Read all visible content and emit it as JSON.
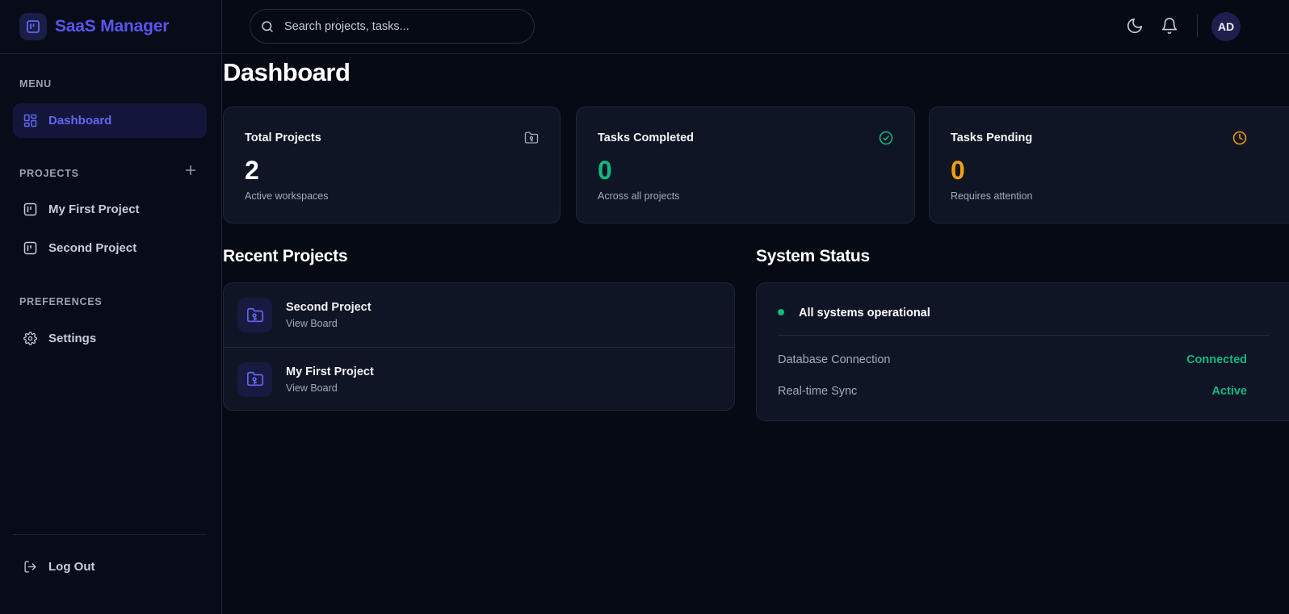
{
  "app": {
    "name": "SaaS Manager",
    "brand_color": "#5b54f0"
  },
  "sidebar": {
    "menu_label": "MENU",
    "menu_items": [
      {
        "label": "Dashboard",
        "icon": "grid-icon",
        "active": true
      }
    ],
    "projects_label": "PROJECTS",
    "projects": [
      {
        "label": "My First Project",
        "icon": "board-icon"
      },
      {
        "label": "Second Project",
        "icon": "board-icon"
      }
    ],
    "preferences_label": "PREFERENCES",
    "preference_items": [
      {
        "label": "Settings",
        "icon": "gear-icon"
      }
    ],
    "logout_label": "Log Out"
  },
  "header": {
    "search_placeholder": "Search projects, tasks...",
    "avatar_initials": "AD"
  },
  "main": {
    "title": "Dashboard",
    "stats": [
      {
        "title": "Total Projects",
        "value": "2",
        "subtitle": "Active workspaces",
        "color": "#ffffff",
        "icon": "folder-icon"
      },
      {
        "title": "Tasks Completed",
        "value": "0",
        "subtitle": "Across all projects",
        "color": "#10b981",
        "icon": "check-circle-icon"
      },
      {
        "title": "Tasks Pending",
        "value": "0",
        "subtitle": "Requires attention",
        "color": "#f59e0b",
        "icon": "clock-icon"
      }
    ],
    "recent_title": "Recent Projects",
    "recent_projects": [
      {
        "name": "Second Project",
        "link": "View Board"
      },
      {
        "name": "My First Project",
        "link": "View Board"
      }
    ],
    "status_title": "System Status",
    "status": {
      "headline": "All systems operational",
      "rows": [
        {
          "label": "Database Connection",
          "value": "Connected"
        },
        {
          "label": "Real-time Sync",
          "value": "Active"
        }
      ],
      "ok_color": "#10b981"
    }
  }
}
